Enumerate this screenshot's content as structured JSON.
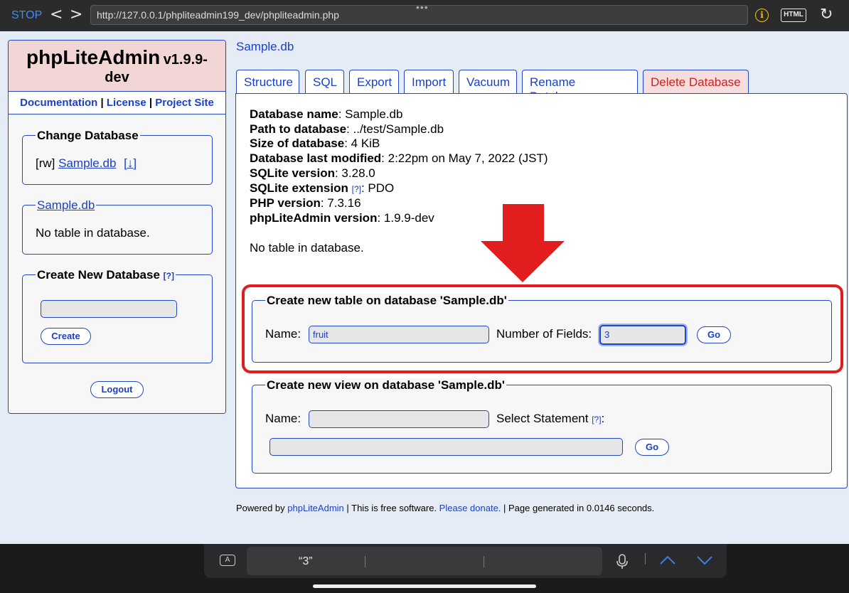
{
  "browser": {
    "stop_label": "STOP",
    "back_glyph": "<",
    "forward_glyph": ">",
    "url": "http://127.0.0.1/phpliteadmin199_dev/phpliteadmin.php",
    "more_glyph": "•••",
    "info_glyph": "i",
    "html_label": "HTML",
    "reload_glyph": "↻"
  },
  "sidebar": {
    "app_name": "phpLiteAdmin",
    "version": "v1.9.9-",
    "version_line2": "dev",
    "links": {
      "documentation": "Documentation",
      "sep1": " | ",
      "license": "License",
      "sep2": " | ",
      "project_site": "Project Site"
    },
    "change_db": {
      "legend": "Change Database",
      "mode": "[rw]",
      "db_name": "Sample.db",
      "download": "[↓]"
    },
    "db_box": {
      "legend": "Sample.db",
      "text": "No table in database."
    },
    "create_db": {
      "legend": "Create New Database",
      "help": "[?]",
      "input_value": "",
      "button": "Create"
    },
    "logout": "Logout"
  },
  "main": {
    "breadcrumb": "Sample.db",
    "tabs": [
      {
        "label": "Structure"
      },
      {
        "label": "SQL"
      },
      {
        "label": "Export"
      },
      {
        "label": "Import"
      },
      {
        "label": "Vacuum"
      },
      {
        "label": "Rename Database"
      },
      {
        "label": "Delete Database"
      }
    ],
    "info": {
      "db_name_label": "Database name",
      "db_name": ": Sample.db",
      "path_label": "Path to database",
      "path": ": ../test/Sample.db",
      "size_label": "Size of database",
      "size": ": 4 KiB",
      "modified_label": "Database last modified",
      "modified": ": 2:22pm on May 7, 2022 (JST)",
      "sqlite_version_label": "SQLite version",
      "sqlite_version": ": 3.28.0",
      "sqlite_ext_label": "SQLite extension",
      "sqlite_ext_help": "[?]",
      "sqlite_ext": ": PDO",
      "php_version_label": "PHP version",
      "php_version": ": 7.3.16",
      "pla_version_label": "phpLiteAdmin version",
      "pla_version": ": 1.9.9-dev",
      "no_table": "No table in database."
    },
    "create_table": {
      "legend": "Create new table on database 'Sample.db'",
      "name_label": "Name:",
      "name_value": "fruit",
      "fields_label": "Number of Fields:",
      "fields_value": "3",
      "go": "Go"
    },
    "create_view": {
      "legend": "Create new view on database 'Sample.db'",
      "name_label": "Name:",
      "name_value": "",
      "select_label": "Select Statement",
      "select_help": "[?]",
      "select_colon": ":",
      "select_value": "",
      "go": "Go"
    },
    "footer": {
      "powered": "Powered by ",
      "pla_link": "phpLiteAdmin",
      "mid": " | This is free software. ",
      "donate": "Please donate.",
      "end": " | Page generated in 0.0146 seconds."
    }
  },
  "keyboard_bar": {
    "format_icon": "A",
    "suggestion_1": "“3”",
    "suggestion_2": "",
    "suggestion_3": "",
    "mic_icon": "mic-icon",
    "up_glyph": "︿",
    "down_glyph": "﹀"
  },
  "annotation": {
    "color": "#e21d1d"
  }
}
